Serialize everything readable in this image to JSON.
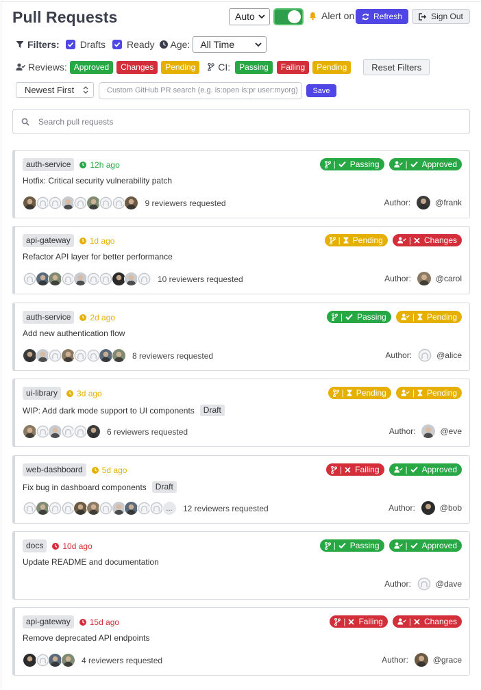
{
  "header": {
    "title": "Pull Requests",
    "theme_select": "Auto",
    "alert_label": "Alert on",
    "refresh_label": "Refresh",
    "signout_label": "Sign Out"
  },
  "filters": {
    "filters_label": "Filters:",
    "drafts_label": "Drafts",
    "ready_label": "Ready",
    "age_label": "Age:",
    "age_value": "All Time",
    "reviews_label": "Reviews:",
    "review_chips": [
      "Approved",
      "Changes",
      "Pending"
    ],
    "ci_label": "CI:",
    "ci_chips": [
      "Passing",
      "Failing",
      "Pending"
    ],
    "reset_label": "Reset Filters",
    "sort_value": "Newest First",
    "custom_search_placeholder": "Custom GitHub PR search (e.g. is:open is:pr user:myorg)",
    "save_label": "Save",
    "search_placeholder": "Search pull requests"
  },
  "colors": {
    "accent": "#4f46e5",
    "green": "#28a745",
    "red": "#d32f3a",
    "yellow": "#e6b000"
  },
  "pull_requests": [
    {
      "repo": "auth-service",
      "age": "12h ago",
      "age_color": "#28a745",
      "ci": "Passing",
      "ci_status": "pass",
      "review": "Approved",
      "review_status": "pass",
      "title": "Hotfix: Critical security vulnerability patch",
      "draft": null,
      "reviewers_text": "9 reviewers requested",
      "author_label": "Author:",
      "author": "@frank"
    },
    {
      "repo": "api-gateway",
      "age": "1d ago",
      "age_color": "#e6b000",
      "ci": "Pending",
      "ci_status": "pending",
      "review": "Changes",
      "review_status": "fail",
      "title": "Refactor API layer for better performance",
      "draft": null,
      "reviewers_text": "10 reviewers requested",
      "author_label": "Author:",
      "author": "@carol"
    },
    {
      "repo": "auth-service",
      "age": "2d ago",
      "age_color": "#e6b000",
      "ci": "Passing",
      "ci_status": "pass",
      "review": "Pending",
      "review_status": "pending",
      "title": "Add new authentication flow",
      "draft": null,
      "reviewers_text": "8 reviewers requested",
      "author_label": "Author:",
      "author": "@alice"
    },
    {
      "repo": "ui-library",
      "age": "3d ago",
      "age_color": "#e6b000",
      "ci": "Pending",
      "ci_status": "pending",
      "review": "Pending",
      "review_status": "pending",
      "title": "WIP: Add dark mode support to UI components",
      "draft": "Draft",
      "reviewers_text": "6 reviewers requested",
      "author_label": "Author:",
      "author": "@eve"
    },
    {
      "repo": "web-dashboard",
      "age": "5d ago",
      "age_color": "#e6b000",
      "ci": "Failing",
      "ci_status": "fail",
      "review": "Approved",
      "review_status": "pass",
      "title": "Fix bug in dashboard components",
      "draft": "Draft",
      "reviewers_text": "12 reviewers requested",
      "more": "...",
      "author_label": "Author:",
      "author": "@bob"
    },
    {
      "repo": "docs",
      "age": "10d ago",
      "age_color": "#d32f3a",
      "ci": "Passing",
      "ci_status": "pass",
      "review": "Approved",
      "review_status": "pass",
      "title": "Update README and documentation",
      "draft": null,
      "reviewers_text": "",
      "author_label": "Author:",
      "author": "@dave"
    },
    {
      "repo": "api-gateway",
      "age": "15d ago",
      "age_color": "#d32f3a",
      "ci": "Failing",
      "ci_status": "fail",
      "review": "Changes",
      "review_status": "fail",
      "title": "Remove deprecated API endpoints",
      "draft": null,
      "reviewers_text": "4 reviewers requested",
      "author_label": "Author:",
      "author": "@grace"
    }
  ]
}
